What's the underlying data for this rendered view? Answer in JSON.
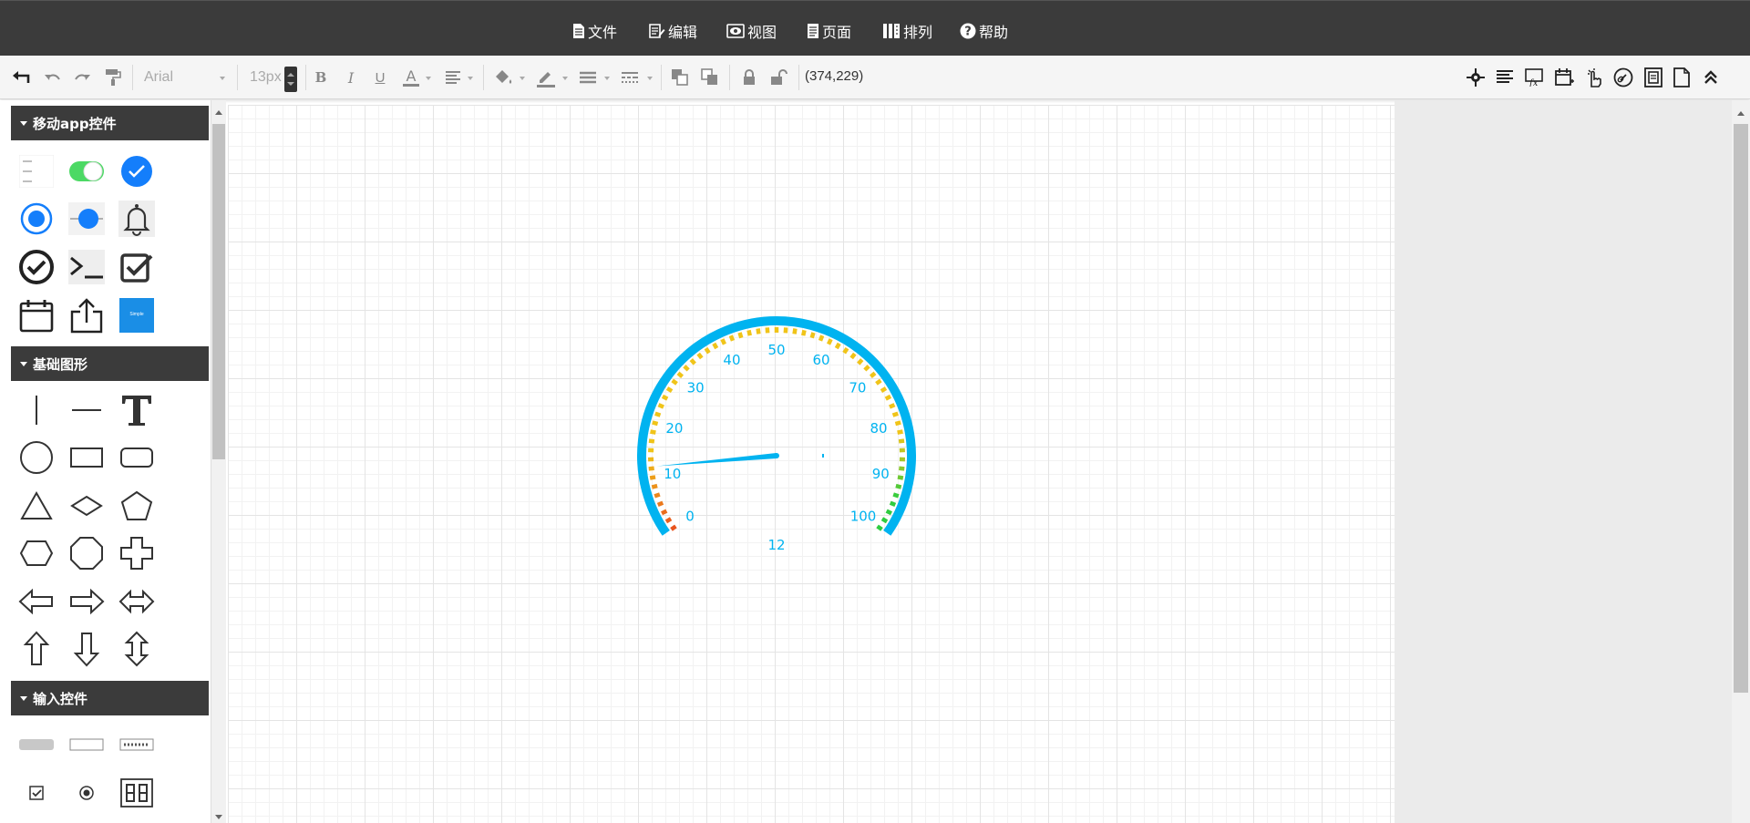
{
  "menubar": {
    "items": [
      {
        "label": "文件",
        "icon": "file-icon"
      },
      {
        "label": "编辑",
        "icon": "edit-icon"
      },
      {
        "label": "视图",
        "icon": "eye-icon"
      },
      {
        "label": "页面",
        "icon": "page-icon"
      },
      {
        "label": "排列",
        "icon": "columns-icon"
      },
      {
        "label": "帮助",
        "icon": "help-icon"
      }
    ]
  },
  "toolbar": {
    "font_family": "Arial",
    "font_size": "13px",
    "coordinates": "(374,229)"
  },
  "sidebar": {
    "sections": [
      {
        "title": "移动app控件"
      },
      {
        "title": "基础图形"
      },
      {
        "title": "输入控件"
      }
    ],
    "button_shape_label": "Simple"
  },
  "gauge": {
    "ticks": [
      "0",
      "10",
      "20",
      "30",
      "40",
      "50",
      "60",
      "70",
      "80",
      "90",
      "100"
    ],
    "value": 12,
    "value_label": "12",
    "colors": {
      "outer_ring": "#00b3f0",
      "low": "#e8541d",
      "mid": "#f0c419",
      "high": "#2ecc40",
      "labels": "#00b3f0"
    }
  }
}
